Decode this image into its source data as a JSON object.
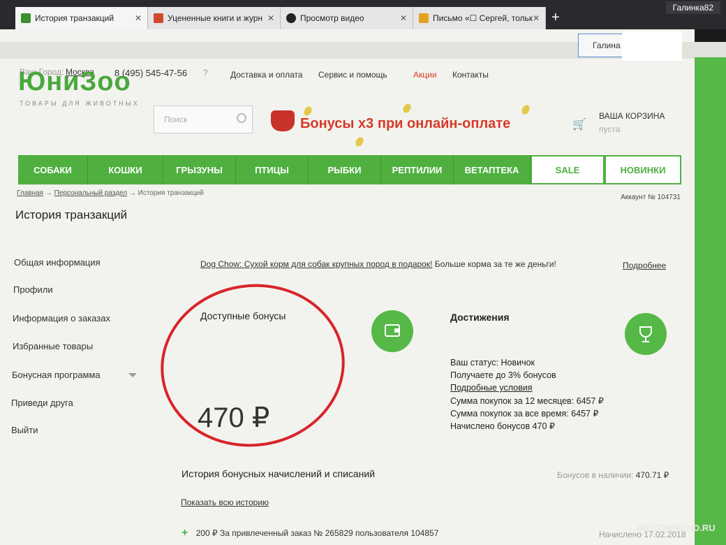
{
  "browser": {
    "tabs": [
      {
        "label": "История транзакций",
        "fav": "#3a8f2e"
      },
      {
        "label": "Уцененные книги и журн",
        "fav": "#d04a2a"
      },
      {
        "label": "Просмотр видео",
        "fav": "#222222"
      },
      {
        "label": "Письмо «☐ Сергей, тольк",
        "fav": "#e6a21f"
      }
    ],
    "new_tab": "+",
    "profile": "Галинка82"
  },
  "header": {
    "city_label": "Ваш Город:",
    "city": "Москва",
    "phone": "8 (495) 545-47-56",
    "help": "?",
    "links": [
      "Доставка и оплата",
      "Сервис и помощь",
      "Акции",
      "Контакты"
    ],
    "login_name": "Галина"
  },
  "brand": {
    "logo": "ЮниЗоо",
    "tagline": "ТОВАРЫ ДЛЯ ЖИВОТНЫХ"
  },
  "search": {
    "placeholder": "Поиск"
  },
  "banner": {
    "text": "Бонусы х3 при онлайн-оплате"
  },
  "cart": {
    "label": "ВАША КОРЗИНА",
    "status": "пуста"
  },
  "nav": [
    "СОБАКИ",
    "КОШКИ",
    "ГРЫЗУНЫ",
    "ПТИЦЫ",
    "РЫБКИ",
    "РЕПТИЛИИ",
    "ВЕТАПТЕКА",
    "SALE",
    "НОВИНКИ"
  ],
  "breadcrumb": {
    "home": "Главная",
    "personal": "Персональный раздел",
    "current": "История транзакций",
    "sep": "→"
  },
  "account": "Аккаунт № 104731",
  "page_title": "История транзакций",
  "sidebar": [
    "Общая информация",
    "Профили",
    "Информация о заказах",
    "Избранные товары",
    "Бонусная программа",
    "Приведи друга",
    "Выйти"
  ],
  "promo": {
    "link": "Dog Chow: Сухой корм для собак крупных пород в подарок!",
    "text": "Больше корма за те же деньги!",
    "more": "Подробнее"
  },
  "bonuses": {
    "title": "Доступные бонусы",
    "amount": "470 ₽"
  },
  "achievements": {
    "title": "Достижения",
    "lines": [
      "Ваш статус: Новичок",
      "Получаете до 3% бонусов",
      "Подробные условия",
      "Сумма покупок за 12 месяцев: 6457 ₽",
      "Сумма покупок за все время: 6457 ₽",
      "Начислено бонусов 470 ₽"
    ]
  },
  "history": {
    "title": "История бонусных начислений и списаний",
    "balance_label": "Бонусов в наличии:",
    "balance": "470.71 ₽",
    "show_all": "Показать всю историю",
    "row": "200 ₽ За привлеченный заказ № 265829 пользователя 104857",
    "row_date": "Начислено 17.02.2018"
  },
  "watermark": "iRECOMMEND.RU"
}
